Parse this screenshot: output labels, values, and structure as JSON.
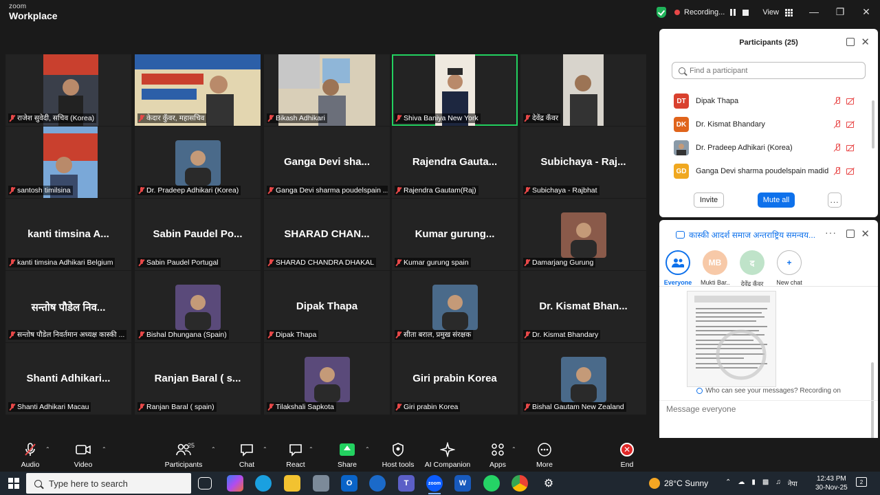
{
  "app": {
    "brand_top": "zoom",
    "brand_bottom": "Workplace",
    "recording_label": "Recording...",
    "view_label": "View"
  },
  "tiles": [
    {
      "name": "राजेश सुवेदी, सचिव (Korea)",
      "big": "",
      "video": true
    },
    {
      "name": "केदार कुँवर, महासचिव",
      "big": "",
      "video": true
    },
    {
      "name": "Bikash Adhikari",
      "big": "",
      "video": true
    },
    {
      "name": "Shiva Baniya New York",
      "big": "",
      "video": true,
      "active": true
    },
    {
      "name": "देवेंद्र कँवर",
      "big": "",
      "video": true
    },
    {
      "name": "santosh timilsina",
      "big": "",
      "video": true
    },
    {
      "name": "Dr. Pradeep Adhikari (Korea)",
      "big": "",
      "avatar": true
    },
    {
      "name": "Ganga Devi sharma poudelspain ...",
      "big": "Ganga Devi sha..."
    },
    {
      "name": "Rajendra Gautam(Raj)",
      "big": "Rajendra Gauta..."
    },
    {
      "name": "Subichaya - Rajbhat",
      "big": "Subichaya - Raj..."
    },
    {
      "name": "kanti timsina Adhikari Belgium",
      "big": "kanti timsina A..."
    },
    {
      "name": "Sabin Paudel Portugal",
      "big": "Sabin Paudel Po..."
    },
    {
      "name": "SHARAD CHANDRA DHAKAL",
      "big": "SHARAD CHAN..."
    },
    {
      "name": "Kumar gurung spain",
      "big": "Kumar gurung..."
    },
    {
      "name": "Damarjang Gurung",
      "big": "",
      "avatar": true
    },
    {
      "name": "सन्तोष पौडेल निवर्तमान अध्यक्ष कास्की ...",
      "big": "सन्तोष पौडेल निव..."
    },
    {
      "name": "Bishal Dhungana (Spain)",
      "big": "",
      "avatar": true
    },
    {
      "name": "Dipak Thapa",
      "big": "Dipak Thapa"
    },
    {
      "name": "सीता बराल, प्रमुख संरक्षक",
      "big": "",
      "avatar": true
    },
    {
      "name": "Dr. Kismat Bhandary",
      "big": "Dr. Kismat Bhan..."
    },
    {
      "name": "Shanti Adhikari Macau",
      "big": "Shanti Adhikari..."
    },
    {
      "name": "Ranjan Baral ( spain)",
      "big": "Ranjan Baral ( s..."
    },
    {
      "name": "Tilakshali Sapkota",
      "big": "",
      "avatar": true
    },
    {
      "name": "Giri prabin Korea",
      "big": "Giri prabin Korea"
    },
    {
      "name": "Bishal Gautam New Zealand",
      "big": "",
      "avatar": true
    }
  ],
  "participants_panel": {
    "title": "Participants (25)",
    "search_placeholder": "Find a participant",
    "rows": [
      {
        "initials": "DT",
        "color": "#d9412e",
        "name": "Dipak Thapa"
      },
      {
        "initials": "DK",
        "color": "#e0641b",
        "name": "Dr. Kismat Bhandary"
      },
      {
        "initials": "",
        "color": "#6b7c8a",
        "name": "Dr. Pradeep Adhikari (Korea)"
      },
      {
        "initials": "GD",
        "color": "#f0a820",
        "name": "Ganga Devi sharma poudelspain madid"
      }
    ],
    "invite": "Invite",
    "mute_all": "Mute all",
    "more": "..."
  },
  "chat_panel": {
    "title": "कास्की आदर्श समाज अन्तराष्ट्रिय समन्वय...",
    "recipients": [
      {
        "initials": "",
        "label": "Everyone"
      },
      {
        "initials": "MB",
        "label": "Mukti Bar..."
      },
      {
        "initials": "द",
        "label": "देवेंद्र कँवर"
      },
      {
        "initials": "+",
        "label": "New chat"
      }
    ],
    "who_can_see": "Who can see your messages? Recording on",
    "message_placeholder": "Message everyone"
  },
  "toolbar": {
    "audio": "Audio",
    "video": "Video",
    "participants": "Participants",
    "participants_count": "25",
    "chat": "Chat",
    "react": "React",
    "share": "Share",
    "host_tools": "Host tools",
    "ai_companion": "AI Companion",
    "apps": "Apps",
    "more": "More",
    "end": "End"
  },
  "taskbar": {
    "search_text": "Type here to search",
    "weather": "28°C  Sunny",
    "lang": "नेपा",
    "time": "12:43 PM",
    "date": "30-Nov-25",
    "notif_count": "2"
  },
  "colors": {
    "accent": "#0e71eb",
    "active_speaker": "#23d160",
    "muted": "#e84848"
  }
}
